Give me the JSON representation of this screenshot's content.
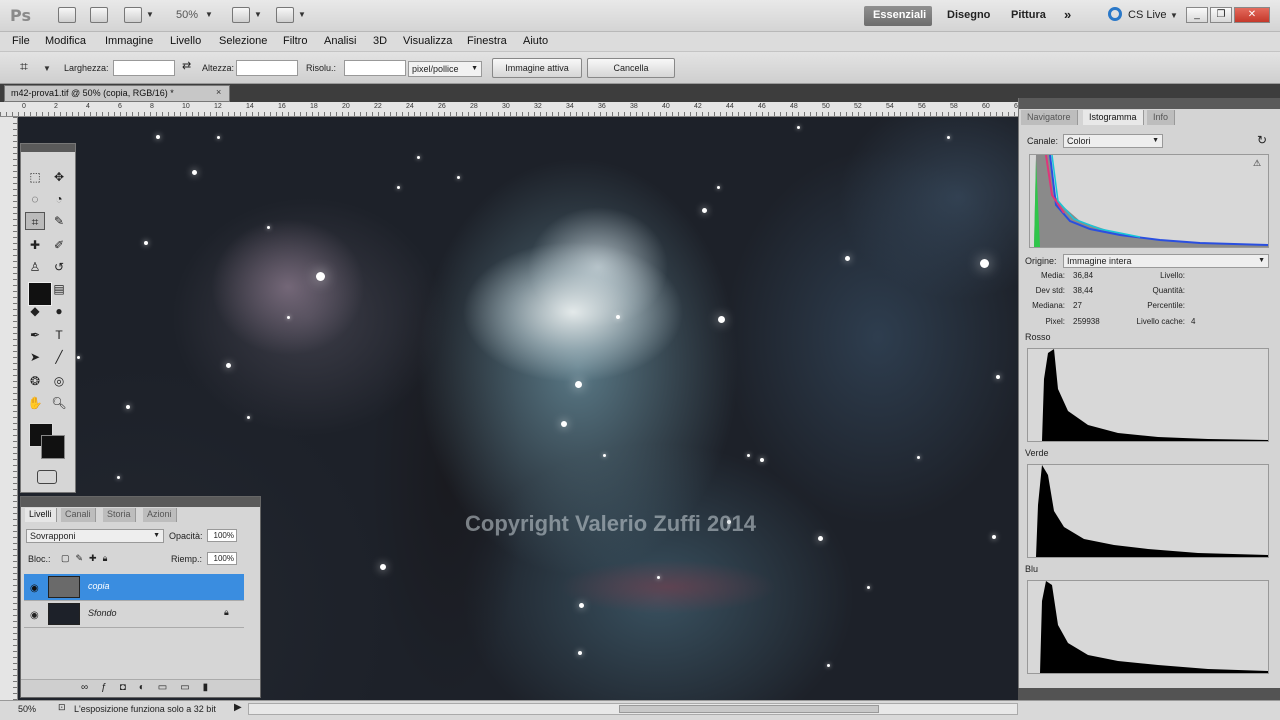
{
  "app": {
    "logo": "Ps",
    "zoom": "50%",
    "ws_essentials": "Essenziali",
    "ws_disegno": "Disegno",
    "ws_pittura": "Pittura",
    "ws_more": "»",
    "cs_live": "CS Live"
  },
  "menu": [
    "File",
    "Modifica",
    "Immagine",
    "Livello",
    "Selezione",
    "Filtro",
    "Analisi",
    "3D",
    "Visualizza",
    "Finestra",
    "Aiuto"
  ],
  "options": {
    "width_label": "Larghezza:",
    "height_label": "Altezza:",
    "res_label": "Risolu.:",
    "unit": "pixel/pollice",
    "btn_front": "Immagine attiva",
    "btn_clear": "Cancella"
  },
  "document": {
    "tab_title": "m42-prova1.tif @ 50% (copia, RGB/16) *",
    "close": "×",
    "watermark": "Copyright Valerio Zuffi 2014"
  },
  "ruler_numbers": [
    "0",
    "2",
    "4",
    "6",
    "8",
    "10",
    "12",
    "14",
    "16",
    "18",
    "20",
    "22",
    "24",
    "26",
    "28",
    "30",
    "32",
    "34",
    "36",
    "38",
    "40",
    "42",
    "44",
    "46",
    "48",
    "50",
    "52",
    "54",
    "56",
    "58",
    "60",
    "62"
  ],
  "layers_panel": {
    "tabs": [
      "Livelli",
      "Canali",
      "Storia",
      "Azioni"
    ],
    "blend_mode": "Sovrapponi",
    "opacity_label": "Opacità:",
    "opacity": "100%",
    "lock_label": "Bloc.:",
    "fill_label": "Riemp.:",
    "fill": "100%",
    "layers": [
      {
        "name": "copia",
        "selected": true
      },
      {
        "name": "Sfondo",
        "selected": false
      }
    ]
  },
  "right_panel": {
    "tabs": [
      "Navigatore",
      "Istogramma",
      "Info"
    ],
    "channel_label": "Canale:",
    "channel": "Colori",
    "source_label": "Origine:",
    "source": "Immagine intera",
    "stats": [
      {
        "label": "Media:",
        "value": "36,84"
      },
      {
        "label": "Dev std:",
        "value": "38,44"
      },
      {
        "label": "Mediana:",
        "value": "27"
      },
      {
        "label": "Pixel:",
        "value": "259938"
      }
    ],
    "stats_right": [
      {
        "label": "Livello:",
        "value": ""
      },
      {
        "label": "Quantità:",
        "value": ""
      },
      {
        "label": "Percentile:",
        "value": ""
      },
      {
        "label": "Livello cache:",
        "value": "4"
      }
    ],
    "channels": [
      "Rosso",
      "Verde",
      "Blu"
    ]
  },
  "status": {
    "zoom": "50%",
    "message": "L'esposizione funziona solo a 32 bit"
  }
}
